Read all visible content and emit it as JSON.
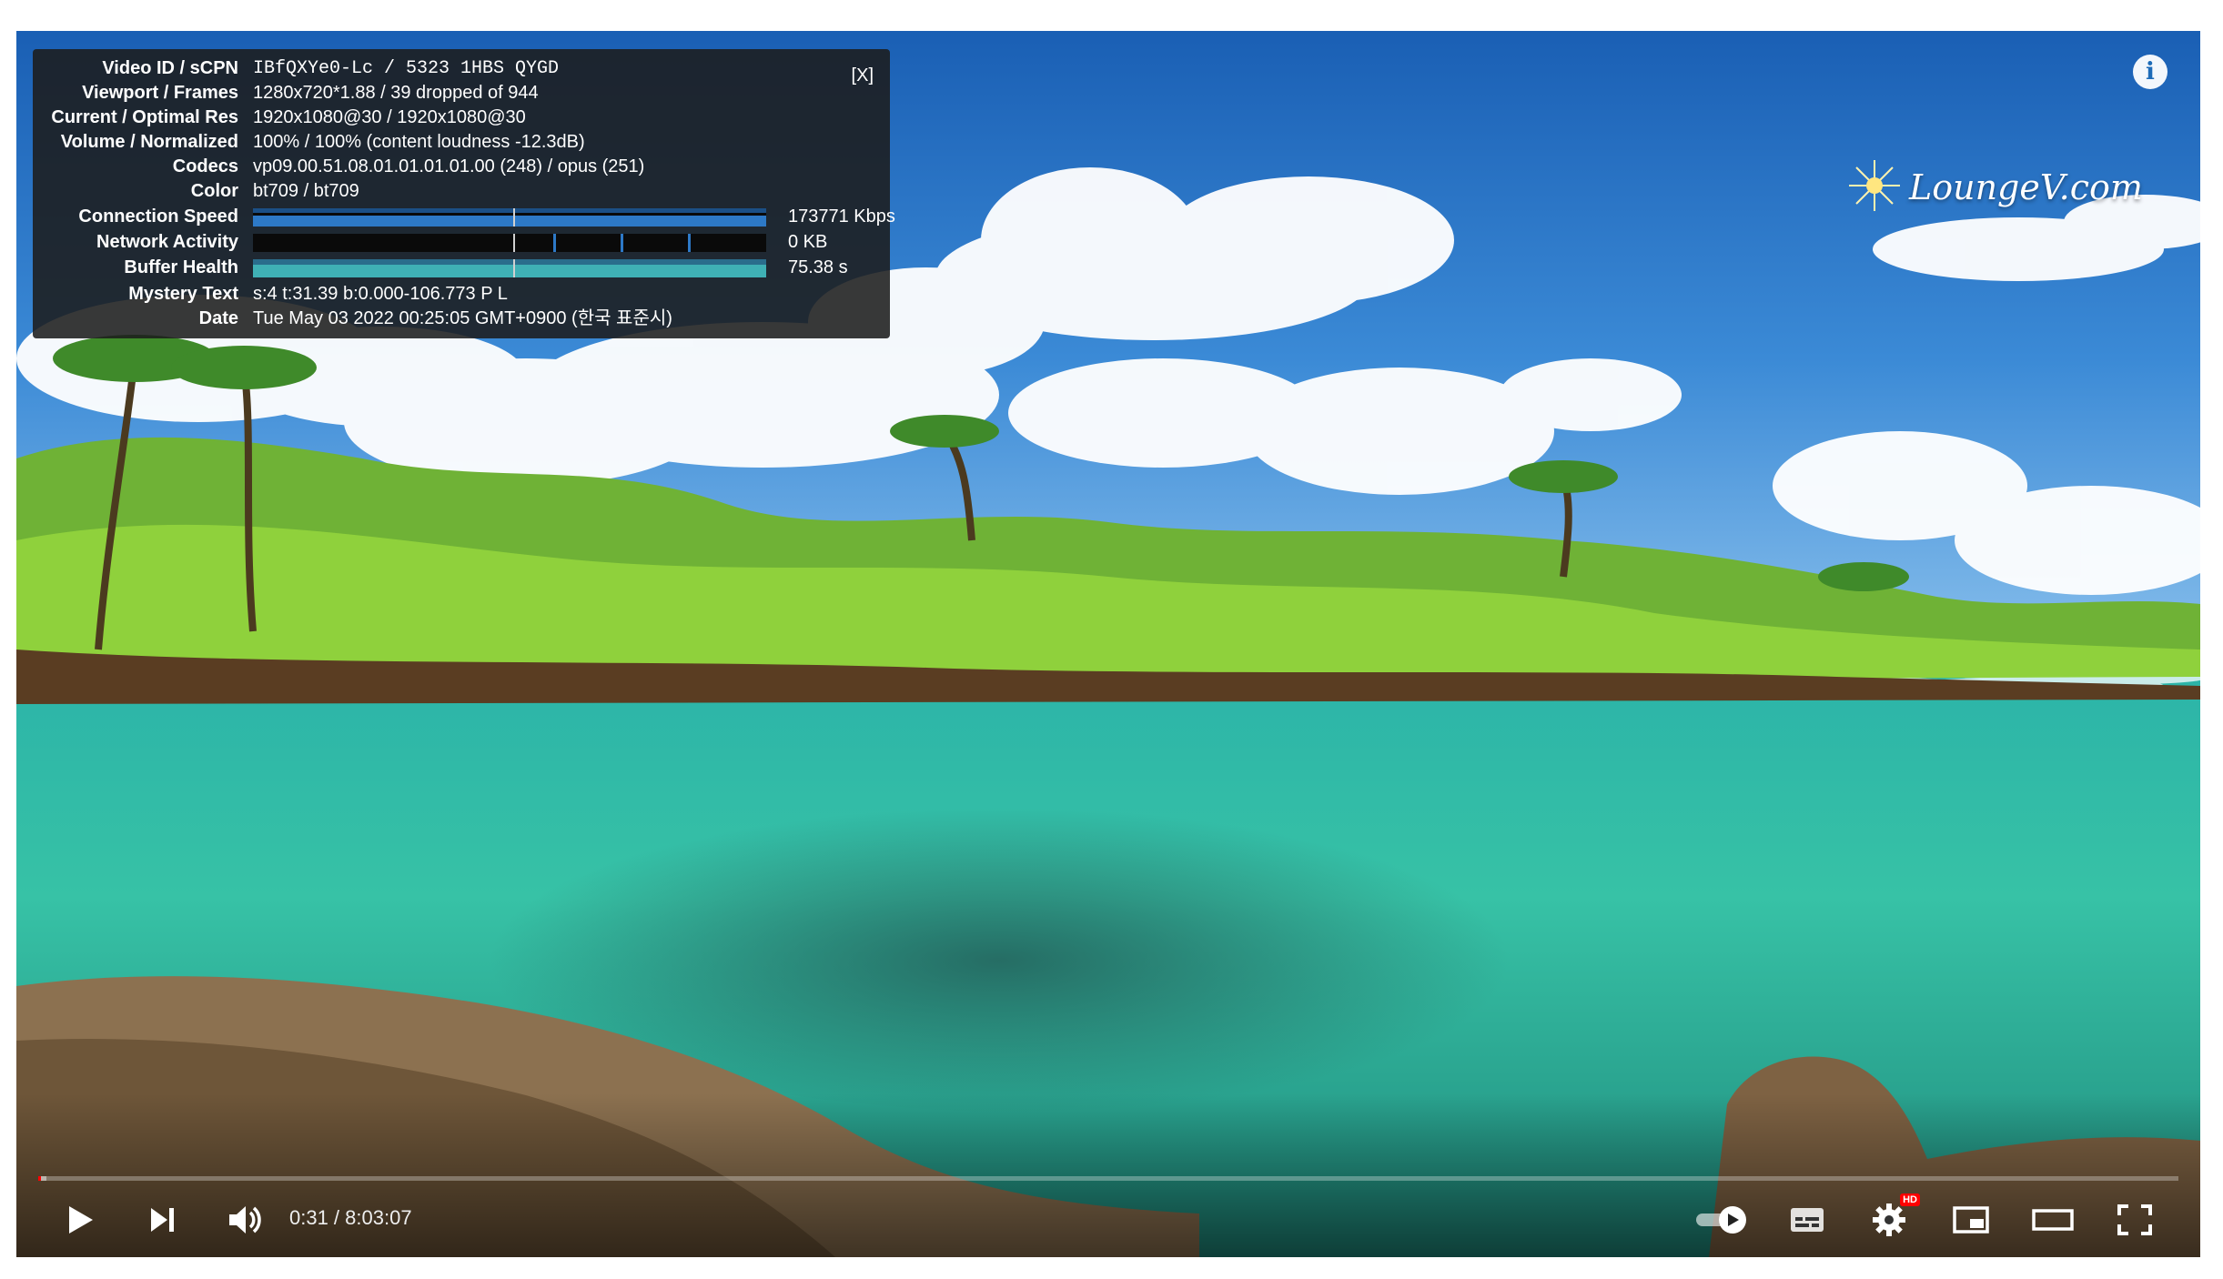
{
  "stats": {
    "close_label": "[X]",
    "rows": [
      {
        "label": "Video ID / sCPN",
        "value": "IBfQXYe0-Lc / 5323 1HBS QYGD"
      },
      {
        "label": "Viewport / Frames",
        "value": "1280x720*1.88 / 39 dropped of 944"
      },
      {
        "label": "Current / Optimal Res",
        "value": "1920x1080@30 / 1920x1080@30"
      },
      {
        "label": "Volume / Normalized",
        "value": "100% / 100% (content loudness -12.3dB)"
      },
      {
        "label": "Codecs",
        "value": "vp09.00.51.08.01.01.01.01.00 (248) / opus (251)"
      },
      {
        "label": "Color",
        "value": "bt709 / bt709"
      },
      {
        "label": "Connection Speed",
        "value": "173771 Kbps"
      },
      {
        "label": "Network Activity",
        "value": "0 KB"
      },
      {
        "label": "Buffer Health",
        "value": "75.38 s"
      },
      {
        "label": "Mystery Text",
        "value": "s:4 t:31.39 b:0.000-106.773 P L"
      },
      {
        "label": "Date",
        "value": "Tue May 03 2022 00:25:05 GMT+0900 (한국 표준시)"
      }
    ]
  },
  "watermark": {
    "text": "LoungeV.com"
  },
  "info_button": {
    "label": "i"
  },
  "controls": {
    "time_display": "0:31 / 8:03:07",
    "progress_played_fraction": 0.0011,
    "progress_loaded_fraction": 0.004,
    "hd_badge": "HD"
  },
  "colors": {
    "overlay_bg": "#1c1c1c",
    "graph_connection": "#2d79c7",
    "graph_buffer": "#3fb0b5",
    "progress_played": "#ff0000"
  },
  "icons": {
    "play": "play-icon",
    "next": "next-icon",
    "volume": "volume-icon",
    "autoplay": "autoplay-toggle-icon",
    "subtitles": "subtitles-icon",
    "settings": "gear-icon",
    "miniplayer": "miniplayer-icon",
    "theater": "theater-mode-icon",
    "fullscreen": "fullscreen-icon"
  }
}
